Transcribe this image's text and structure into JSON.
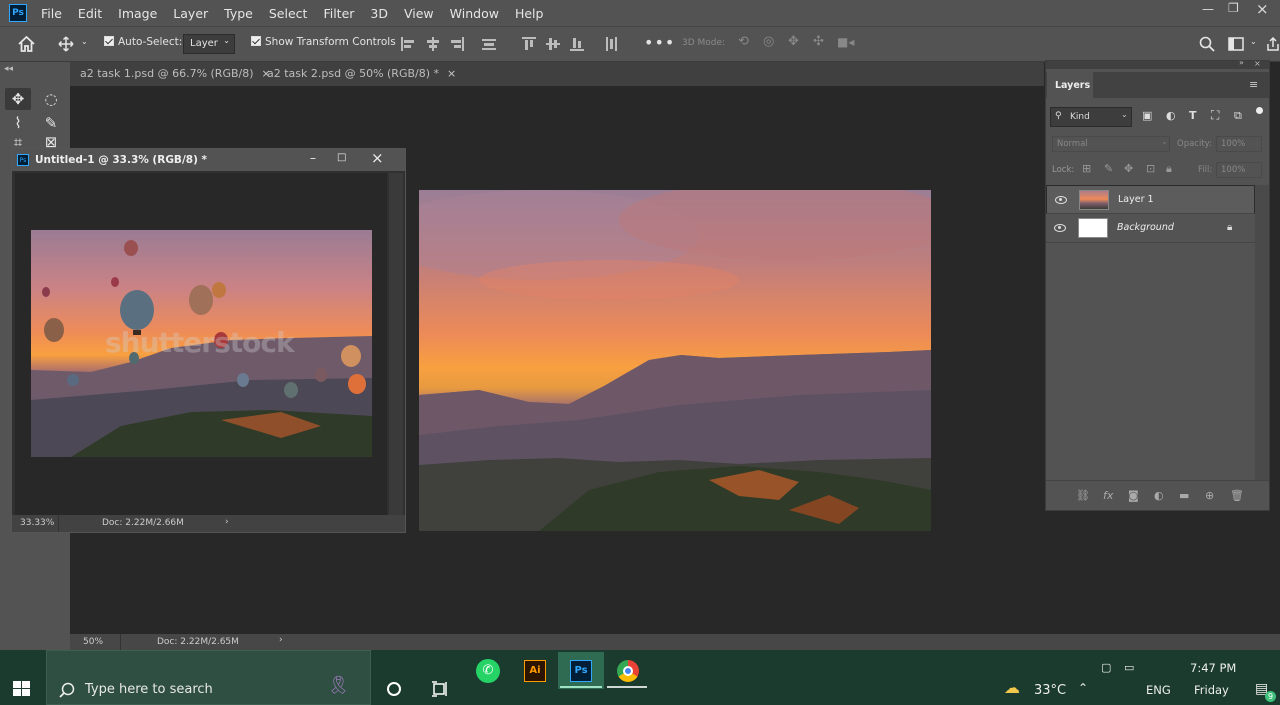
{
  "app": {
    "logo": "Ps"
  },
  "menubar": {
    "items": [
      "File",
      "Edit",
      "Image",
      "Layer",
      "Type",
      "Select",
      "Filter",
      "3D",
      "View",
      "Window",
      "Help"
    ]
  },
  "options": {
    "auto_select_label": "Auto-Select:",
    "auto_select_value": "Layer",
    "show_transform_label": "Show Transform Controls",
    "mode_label": "3D Mode:"
  },
  "tabs": [
    {
      "label": "a2 task 1.psd @ 66.7% (RGB/8)",
      "close": "×"
    },
    {
      "label": "a2 task 2.psd @ 50% (RGB/8) *",
      "close": "×"
    }
  ],
  "floating_window": {
    "title": "Untitled-1 @ 33.3% (RGB/8) *",
    "zoom": "33.33%",
    "doc": "Doc: 2.22M/2.66M",
    "watermark": "shutterstock"
  },
  "statusbar": {
    "zoom": "50%",
    "doc": "Doc: 2.22M/2.65M"
  },
  "layers_panel": {
    "title": "Layers",
    "filter_kind": "Kind",
    "blend_mode": "Normal",
    "opacity_label": "Opacity:",
    "opacity_value": "100%",
    "lock_label": "Lock:",
    "fill_label": "Fill:",
    "fill_value": "100%",
    "layers": [
      {
        "name": "Layer 1",
        "selected": true
      },
      {
        "name": "Background",
        "locked": true
      }
    ],
    "bottom_buttons": [
      "link-icon",
      "fx-icon",
      "mask-icon",
      "adjustment-icon",
      "folder-icon",
      "new-layer-icon",
      "trash-icon"
    ]
  },
  "taskbar": {
    "search_placeholder": "Type here to search",
    "weather": "33°C",
    "language": "ENG",
    "time": "7:47 PM",
    "day": "Friday",
    "notification_count": "9"
  },
  "colors": {
    "accent_ps": "#31a8ff",
    "panel": "#535353",
    "canvas": "#282828",
    "taskbar": "#1a3b2e"
  }
}
